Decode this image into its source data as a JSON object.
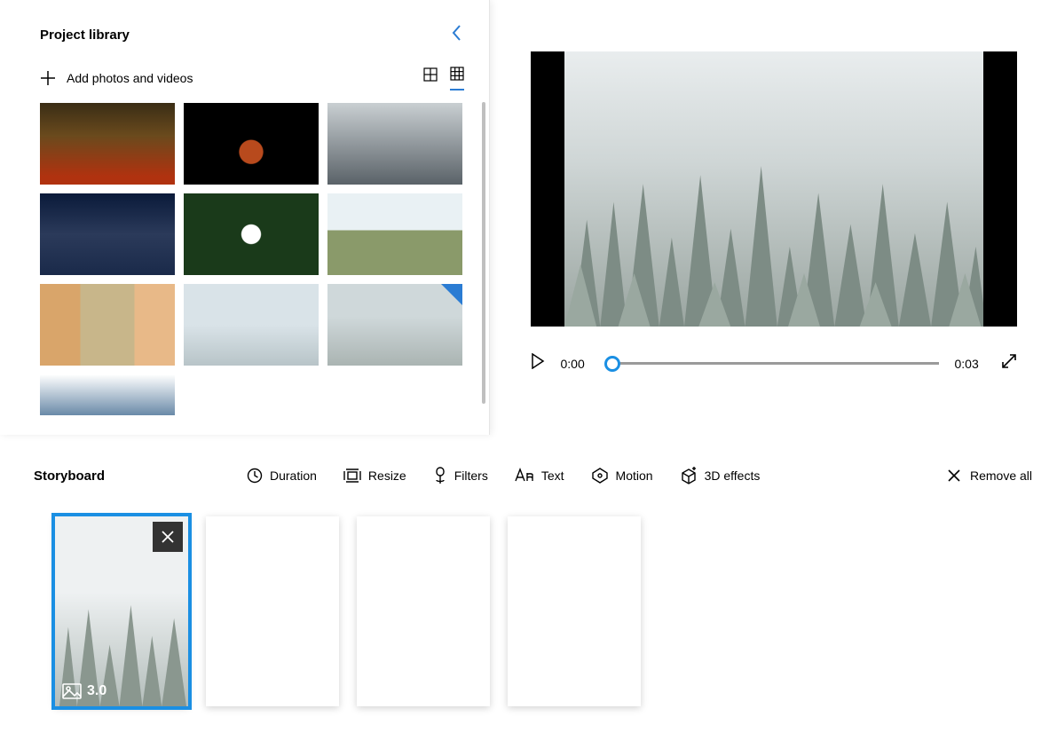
{
  "library": {
    "title": "Project library",
    "add_label": "Add photos and videos",
    "thumbs": [
      {
        "name": "forest-autumn",
        "cls": "bg-forest"
      },
      {
        "name": "bowling-pins",
        "cls": "bg-bowling"
      },
      {
        "name": "glacier-rock",
        "cls": "bg-glacier"
      },
      {
        "name": "canal-city-night",
        "cls": "bg-city"
      },
      {
        "name": "drone-flying",
        "cls": "bg-drone"
      },
      {
        "name": "horses-field",
        "cls": "bg-horses"
      },
      {
        "name": "pisa-tower",
        "cls": "bg-pisa"
      },
      {
        "name": "person-snow",
        "cls": "bg-snow1"
      },
      {
        "name": "snow-forest",
        "cls": "bg-snow2",
        "selected": true
      },
      {
        "name": "waterfall",
        "cls": "bg-waterfall",
        "half": true
      }
    ],
    "view_mode": "small-grid"
  },
  "preview": {
    "current_time": "0:00",
    "total_time": "0:03",
    "progress": 0
  },
  "storyboard": {
    "title": "Storyboard",
    "tools": {
      "duration": "Duration",
      "resize": "Resize",
      "filters": "Filters",
      "text": "Text",
      "motion": "Motion",
      "effects3d": "3D effects"
    },
    "remove_all": "Remove all",
    "clips": [
      {
        "selected": true,
        "duration": "3.0",
        "type": "image",
        "cls": "bg-snowclip"
      },
      {
        "empty": true
      },
      {
        "empty": true
      },
      {
        "empty": true
      }
    ]
  }
}
